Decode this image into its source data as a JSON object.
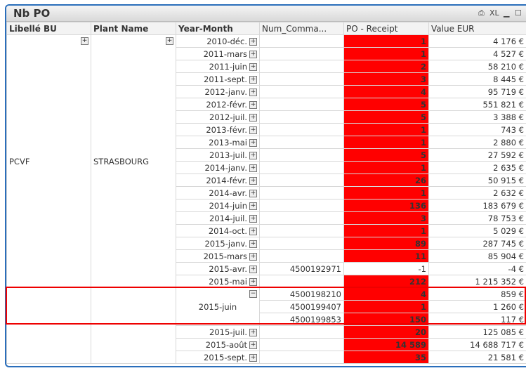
{
  "window": {
    "title": "Nb PO",
    "icons": [
      "print-icon",
      "xl-icon",
      "minimize-icon",
      "maximize-icon"
    ],
    "xl_label": "XL"
  },
  "columns": [
    "Libellé BU",
    "Plant Name",
    "Year-Month",
    "Num_Comma...",
    "PO - Receipt",
    "Value EUR"
  ],
  "bu": "PCVF",
  "plant": "STRASBOURG",
  "rows": [
    {
      "ym": "2010-déc.",
      "num": "",
      "po": "1",
      "val": "4 176 €",
      "red": true
    },
    {
      "ym": "2011-mars",
      "num": "",
      "po": "1",
      "val": "4 527 €",
      "red": true
    },
    {
      "ym": "2011-juin",
      "num": "",
      "po": "2",
      "val": "58 210 €",
      "red": true
    },
    {
      "ym": "2011-sept.",
      "num": "",
      "po": "3",
      "val": "8 445 €",
      "red": true
    },
    {
      "ym": "2012-janv.",
      "num": "",
      "po": "4",
      "val": "95 719 €",
      "red": true
    },
    {
      "ym": "2012-févr.",
      "num": "",
      "po": "5",
      "val": "551 821 €",
      "red": true
    },
    {
      "ym": "2012-juil.",
      "num": "",
      "po": "5",
      "val": "3 388 €",
      "red": true
    },
    {
      "ym": "2013-févr.",
      "num": "",
      "po": "1",
      "val": "743 €",
      "red": true
    },
    {
      "ym": "2013-mai",
      "num": "",
      "po": "1",
      "val": "2 880 €",
      "red": true
    },
    {
      "ym": "2013-juil.",
      "num": "",
      "po": "5",
      "val": "27 592 €",
      "red": true
    },
    {
      "ym": "2014-janv.",
      "num": "",
      "po": "1",
      "val": "2 635 €",
      "red": true
    },
    {
      "ym": "2014-févr.",
      "num": "",
      "po": "26",
      "val": "50 915 €",
      "red": true
    },
    {
      "ym": "2014-avr.",
      "num": "",
      "po": "1",
      "val": "2 632 €",
      "red": true
    },
    {
      "ym": "2014-juin",
      "num": "",
      "po": "136",
      "val": "183 679 €",
      "red": true
    },
    {
      "ym": "2014-juil.",
      "num": "",
      "po": "3",
      "val": "78 753 €",
      "red": true
    },
    {
      "ym": "2014-oct.",
      "num": "",
      "po": "1",
      "val": "5 029 €",
      "red": true
    },
    {
      "ym": "2015-janv.",
      "num": "",
      "po": "89",
      "val": "287 745 €",
      "red": true
    },
    {
      "ym": "2015-mars",
      "num": "",
      "po": "11",
      "val": "85 904 €",
      "red": true
    },
    {
      "ym": "2015-avr.",
      "num": "4500192971",
      "po": "-1",
      "val": "-4 €",
      "red": false
    },
    {
      "ym": "2015-mai",
      "num": "",
      "po": "212",
      "val": "1 215 352 €",
      "red": true
    }
  ],
  "expanded": {
    "ym": "2015-juin",
    "rows": [
      {
        "num": "4500198210",
        "po": "4",
        "val": "859 €"
      },
      {
        "num": "4500199407",
        "po": "1",
        "val": "1 260 €"
      },
      {
        "num": "4500199853",
        "po": "150",
        "val": "117 €"
      }
    ]
  },
  "rows_after": [
    {
      "ym": "2015-juil.",
      "po": "20",
      "val": "125 085 €"
    },
    {
      "ym": "2015-août",
      "po": "14 589",
      "val": "14 688 717 €"
    },
    {
      "ym": "2015-sept.",
      "po": "35",
      "val": "21 581 €"
    }
  ]
}
